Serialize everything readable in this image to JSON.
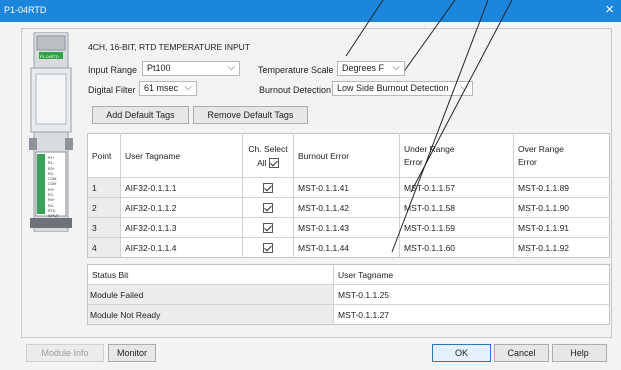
{
  "window": {
    "title": "P1-04RTD"
  },
  "module": {
    "image_label": "P1-04RTD",
    "description": "4CH, 16-BIT, RTD TEMPERATURE INPUT",
    "terminal_labels": [
      "R1+",
      "R1-",
      "R2+",
      "R2-",
      "COM",
      "COM",
      "R3+",
      "R3-",
      "R4+",
      "R4-",
      "RTD INPUT"
    ]
  },
  "settings": {
    "input_range_label": "Input Range",
    "input_range_value": "Pt100",
    "temp_scale_label": "Temperature Scale",
    "temp_scale_value": "Degrees F",
    "digital_filter_label": "Digital Filter",
    "digital_filter_value": "61 msec",
    "burnout_label": "Burnout Detection",
    "burnout_value": "Low Side Burnout Detection"
  },
  "buttons": {
    "add_tags": "Add Default Tags",
    "remove_tags": "Remove Default Tags",
    "module_info": "Module Info",
    "monitor": "Monitor",
    "ok": "OK",
    "cancel": "Cancel",
    "help": "Help"
  },
  "channel_table": {
    "headers": {
      "point": "Point",
      "user_tagname": "User Tagname",
      "ch_select": "Ch. Select",
      "all": "All",
      "burnout_error": "Burnout Error",
      "under_range": "Under Range Error",
      "over_range": "Over Range Error"
    },
    "rows": [
      {
        "point": "1",
        "tag": "AIF32-0.1.1.1",
        "checked": true,
        "burnout": "MST-0.1.1.41",
        "under": "MST-0.1.1.57",
        "over": "MST-0.1.1.89"
      },
      {
        "point": "2",
        "tag": "AIF32-0.1.1.2",
        "checked": true,
        "burnout": "MST-0.1.1.42",
        "under": "MST-0.1.1.58",
        "over": "MST-0.1.1.90"
      },
      {
        "point": "3",
        "tag": "AIF32-0.1.1.3",
        "checked": true,
        "burnout": "MST-0.1.1.43",
        "under": "MST-0.1.1.59",
        "over": "MST-0.1.1.91"
      },
      {
        "point": "4",
        "tag": "AIF32-0.1.1.4",
        "checked": true,
        "burnout": "MST-0.1.1.44",
        "under": "MST-0.1.1.60",
        "over": "MST-0.1.1.92"
      }
    ]
  },
  "status_table": {
    "headers": {
      "status_bit": "Status Bit",
      "user_tagname": "User Tagname"
    },
    "rows": [
      {
        "bit": "Module Failed",
        "tag": "MST-0.1.1.25"
      },
      {
        "bit": "Module Not Ready",
        "tag": "MST-0.1.1.27"
      }
    ]
  },
  "colors": {
    "titlebar": "#1c86dd",
    "default_button_border": "#2a77c9",
    "annotation_lines": "#222222"
  }
}
